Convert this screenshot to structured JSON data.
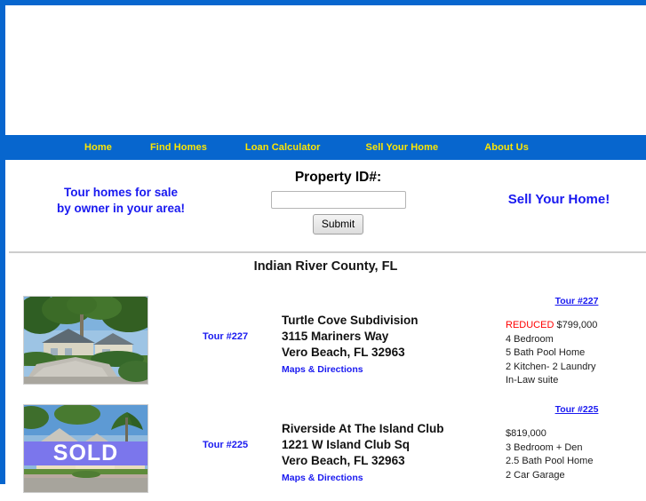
{
  "theme": {
    "brand_blue": "#0766ce",
    "nav_text_yellow": "#ffe600",
    "link_blue": "#1919f0",
    "reduced_red": "#ff0000",
    "sold_band": "#7b76ec"
  },
  "nav": {
    "items": [
      {
        "label": "Home",
        "name": "nav-home"
      },
      {
        "label": "Find Homes",
        "name": "nav-find-homes"
      },
      {
        "label": "Loan Calculator",
        "name": "nav-loan-calculator"
      },
      {
        "label": "Sell Your Home",
        "name": "nav-sell-your-home"
      },
      {
        "label": "About Us",
        "name": "nav-about-us"
      }
    ]
  },
  "band": {
    "promo_left_line1": "Tour homes for sale",
    "promo_left_line2": "by owner in your area!",
    "promo_right": "Sell Your Home!",
    "search_title": "Property ID#:",
    "search_value": "",
    "search_placeholder": "",
    "submit_label": "Submit"
  },
  "county_heading": "Indian River County, FL",
  "listings": [
    {
      "tour_label_mid": "Tour #227",
      "tour_label_top": "Tour #227",
      "subdivision": "Turtle Cove Subdivision",
      "street": "3115 Mariners Way",
      "citystatezip": "Vero Beach, FL 32963",
      "maps_label": "Maps & Directions",
      "status_tag": "REDUCED",
      "price": "$799,000",
      "specs": [
        "4 Bedroom",
        "5 Bath Pool Home",
        "2 Kitchen- 2 Laundry",
        "In-Law suite"
      ],
      "photo_alt": "single-story-home-with-driveway-and-palms",
      "sold": false,
      "sold_label": ""
    },
    {
      "tour_label_mid": "Tour #225",
      "tour_label_top": "Tour #225",
      "subdivision": "Riverside At The Island Club",
      "street": "1221 W Island Club Sq",
      "citystatezip": "Vero Beach, FL 32963",
      "maps_label": "Maps & Directions",
      "status_tag": "",
      "price": "$819,000",
      "specs": [
        "3 Bedroom + Den",
        "2.5 Bath Pool Home",
        "2 Car Garage"
      ],
      "photo_alt": "two-tan-homes-with-palm-trees",
      "sold": true,
      "sold_label": "SOLD"
    }
  ]
}
